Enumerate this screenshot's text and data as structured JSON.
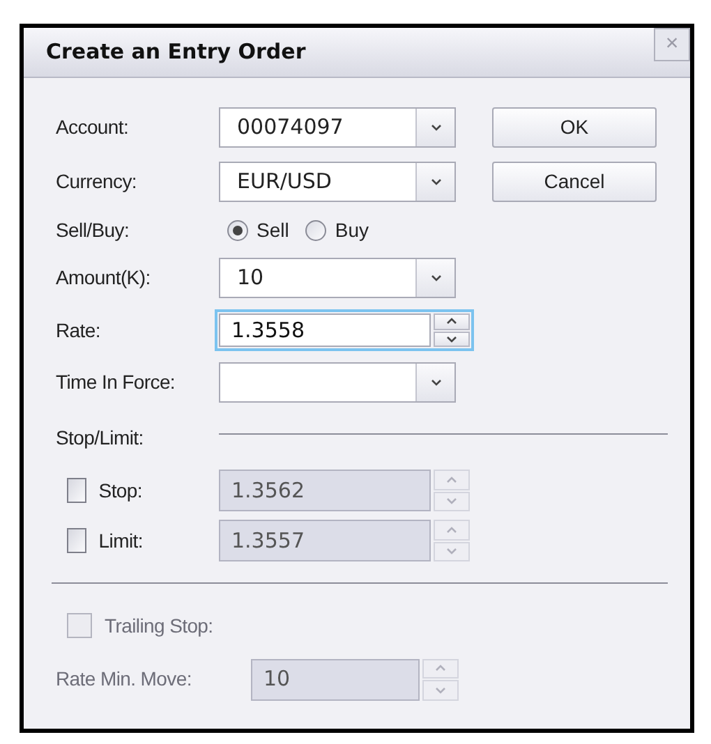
{
  "window": {
    "title": "Create an Entry Order",
    "close_label": "×"
  },
  "buttons": [
    {
      "label": "OK"
    },
    {
      "label": "Cancel"
    }
  ],
  "rows": [
    {
      "kind": "dropdown",
      "label": "Account:",
      "value": "00074097"
    },
    {
      "kind": "dropdown",
      "label": "Currency:",
      "value": "EUR/USD"
    },
    {
      "kind": "radio",
      "label": "Sell/Buy:",
      "options": [
        {
          "label": "Sell",
          "selected": true
        },
        {
          "label": "Buy",
          "selected": false
        }
      ]
    },
    {
      "kind": "combo",
      "label": "Amount(K):",
      "value": "10"
    },
    {
      "kind": "spin",
      "label": "Rate:",
      "value": "1.3558",
      "focused": true,
      "disabled": false
    },
    {
      "kind": "dropdown",
      "label": "Time In Force:"
    },
    {
      "kind": "section",
      "label": "Stop/Limit:"
    },
    {
      "kind": "check_spin",
      "label": "Stop:",
      "checked": false,
      "value": "1.3562",
      "disabled": true
    },
    {
      "kind": "check_spin",
      "label": "Limit:",
      "checked": false,
      "value": "1.3557",
      "disabled": true
    },
    {
      "kind": "divider"
    },
    {
      "kind": "check",
      "label": "Trailing Stop:",
      "checked": false,
      "disabled": true
    },
    {
      "kind": "spin_wide",
      "label": "Rate Min. Move:",
      "value": "10",
      "disabled": true,
      "focused": false
    }
  ]
}
